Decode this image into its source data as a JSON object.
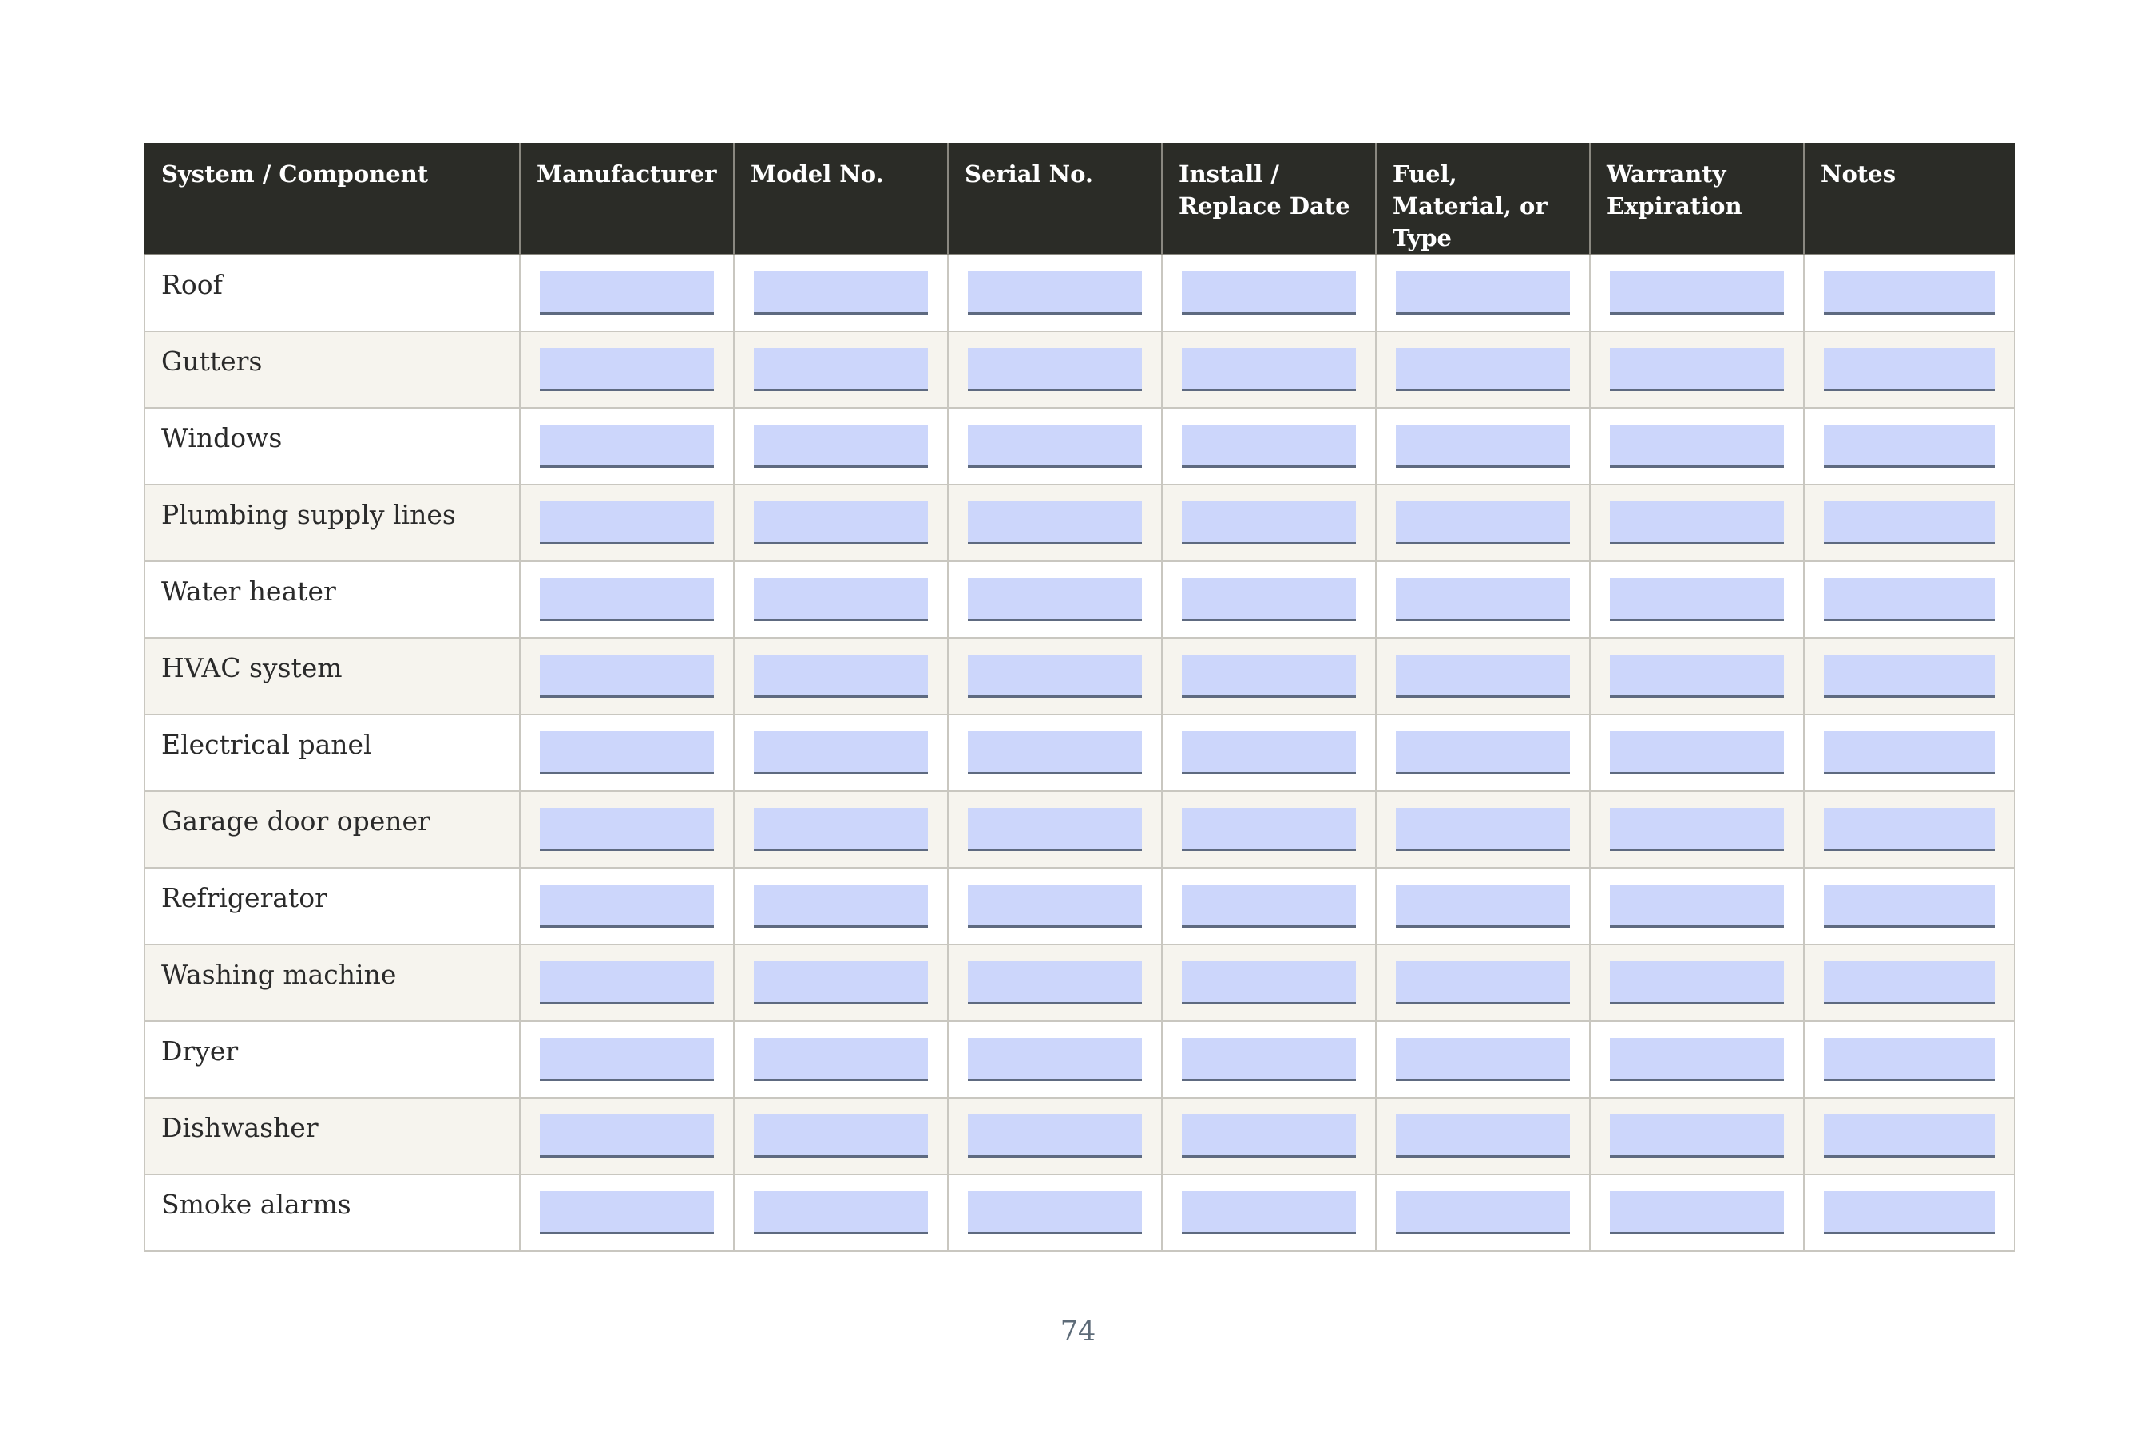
{
  "table": {
    "headers": [
      "System / Component",
      "Manufacturer",
      "Model No.",
      "Serial No.",
      "Install / Replace Date",
      "Fuel, Material, or Type",
      "Warranty Expiration",
      "Notes"
    ],
    "rows": [
      "Roof",
      "Gutters",
      "Windows",
      "Plumbing supply lines",
      "Water heater",
      "HVAC system",
      "Electrical panel",
      "Garage door opener",
      "Refrigerator",
      "Washing machine",
      "Dryer",
      "Dishwasher",
      "Smoke alarms"
    ]
  },
  "footer": {
    "page_number": "74"
  },
  "colors": {
    "header_bg": "#2b2c27",
    "field_fill": "#ccd6fb",
    "alt_row": "#f6f4ee"
  }
}
